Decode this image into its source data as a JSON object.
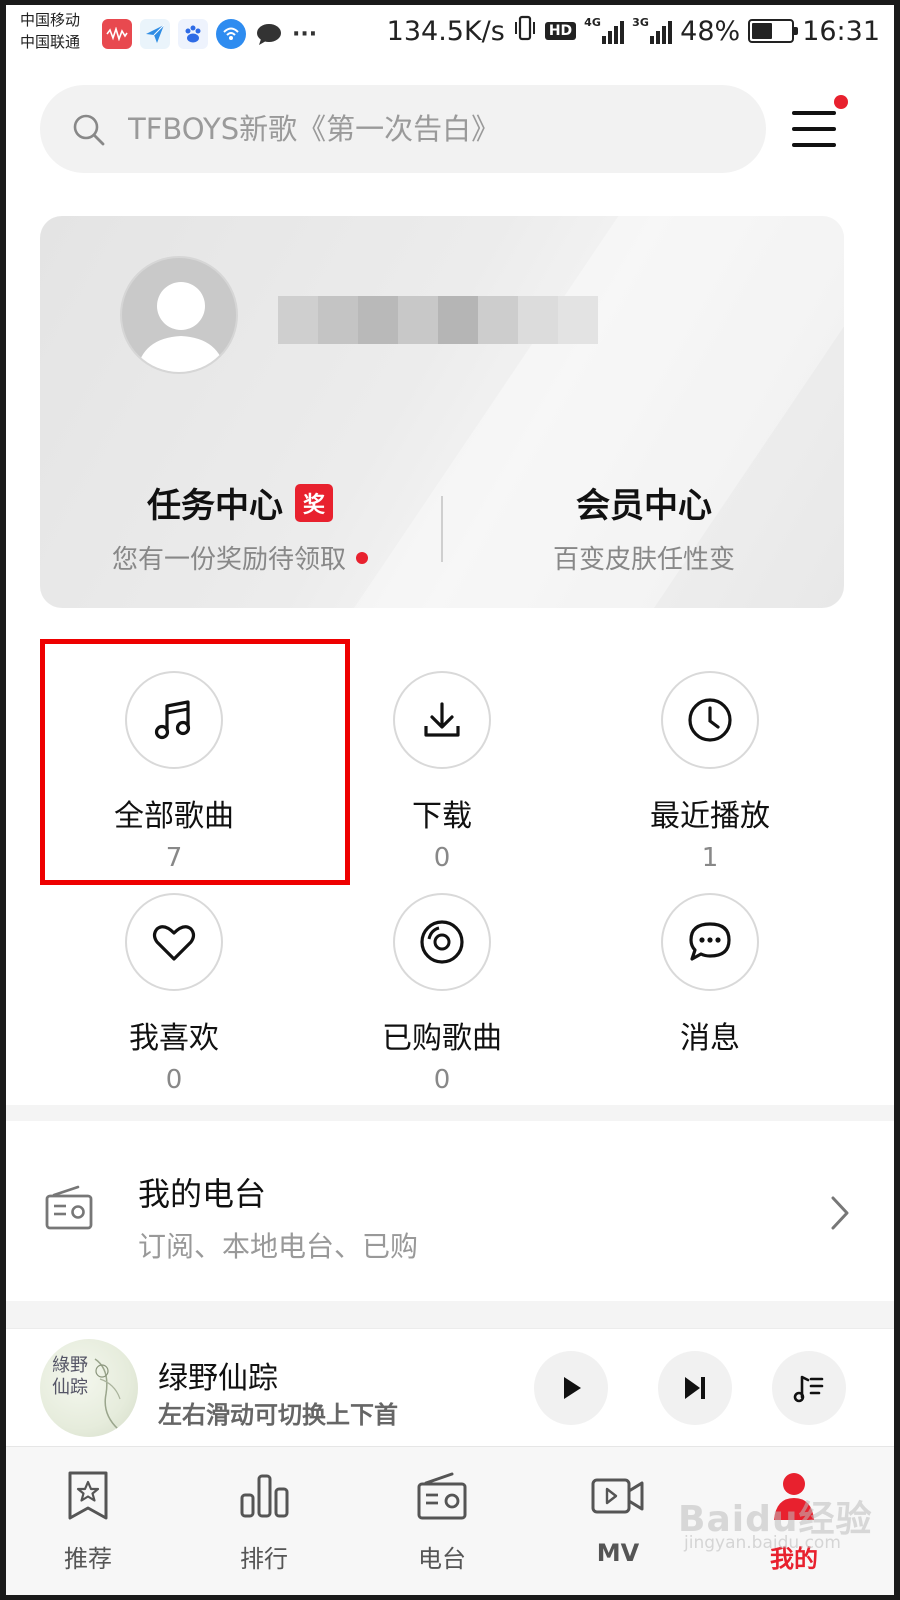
{
  "status_bar": {
    "carrier_1": "中国移动",
    "carrier_2": "中国联通",
    "net_speed": "134.5K/s",
    "hd": "HD",
    "sig1_label": "4G",
    "sig2_label": "3G",
    "battery": "48%",
    "time": "16:31",
    "more": "···"
  },
  "search": {
    "placeholder": "TFBOYS新歌《第一次告白》"
  },
  "menu": {
    "has_notification": true
  },
  "profile": {
    "task_center": {
      "title": "任务中心",
      "badge": "奖",
      "subtitle": "您有一份奖励待领取"
    },
    "vip_center": {
      "title": "会员中心",
      "subtitle": "百变皮肤任性变"
    }
  },
  "grid": [
    {
      "label": "全部歌曲",
      "count": "7",
      "icon": "music-note-icon"
    },
    {
      "label": "下载",
      "count": "0",
      "icon": "download-icon"
    },
    {
      "label": "最近播放",
      "count": "1",
      "icon": "clock-icon"
    },
    {
      "label": "我喜欢",
      "count": "0",
      "icon": "heart-icon"
    },
    {
      "label": "已购歌曲",
      "count": "0",
      "icon": "disc-icon"
    },
    {
      "label": "消息",
      "count": "",
      "icon": "message-icon"
    }
  ],
  "radio": {
    "title": "我的电台",
    "subtitle": "订阅、本地电台、已购"
  },
  "player": {
    "song_title": "绿野仙踪",
    "hint": "左右滑动可切换上下首",
    "cover_text": "綠野仙踪"
  },
  "bottom_nav": [
    {
      "label": "推荐",
      "icon": "star-bookmark-icon"
    },
    {
      "label": "排行",
      "icon": "bar-chart-icon"
    },
    {
      "label": "电台",
      "icon": "radio-icon"
    },
    {
      "label": "MV",
      "icon": "video-camera-icon"
    },
    {
      "label": "我的",
      "icon": "user-icon",
      "active": true
    }
  ],
  "watermark": {
    "main": "Baidu经验",
    "sub": "jingyan.baidu.com"
  },
  "colors": {
    "accent_red": "#e8212e",
    "highlight_box": "#ee0000"
  }
}
